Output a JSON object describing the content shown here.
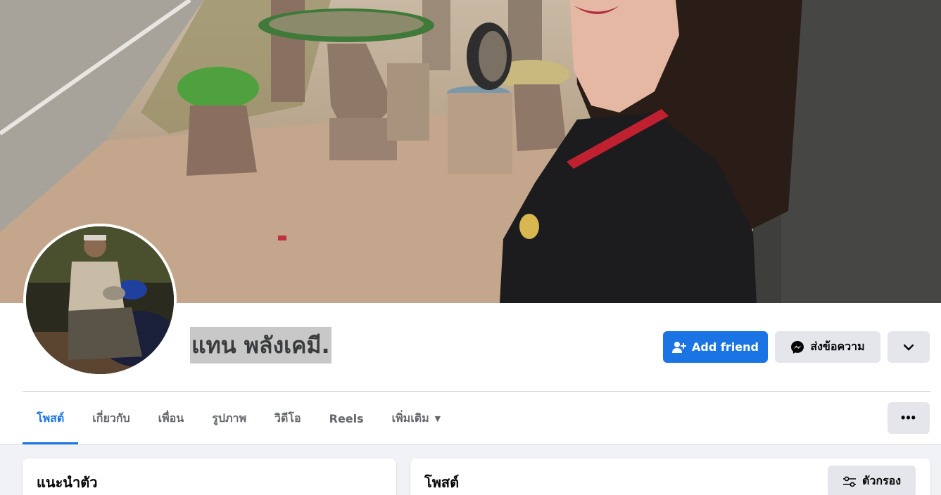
{
  "profile": {
    "name": "แทน พลังเคมี.",
    "add_friend_label": "Add friend",
    "message_label": "ส่งข้อความ"
  },
  "tabs": [
    {
      "label": "โพสต์",
      "active": true
    },
    {
      "label": "เกี่ยวกับ",
      "active": false
    },
    {
      "label": "เพื่อน",
      "active": false
    },
    {
      "label": "รูปภาพ",
      "active": false
    },
    {
      "label": "วิดีโอ",
      "active": false
    },
    {
      "label": "Reels",
      "active": false
    },
    {
      "label": "เพิ่มเติม",
      "active": false
    }
  ],
  "intro": {
    "title": "แนะนำตัว"
  },
  "posts": {
    "title": "โพสต์",
    "filter_label": "ตัวกรอง"
  },
  "icons": {
    "add_friend": "person-plus-icon",
    "message": "messenger-icon",
    "expand": "chevron-down-icon",
    "more": "ellipsis-icon",
    "filter": "sliders-icon",
    "tab_more": "caret-down-icon"
  },
  "colors": {
    "accent": "#1b74e4",
    "button_gray": "#e4e6eb",
    "muted_text": "#65676b"
  }
}
